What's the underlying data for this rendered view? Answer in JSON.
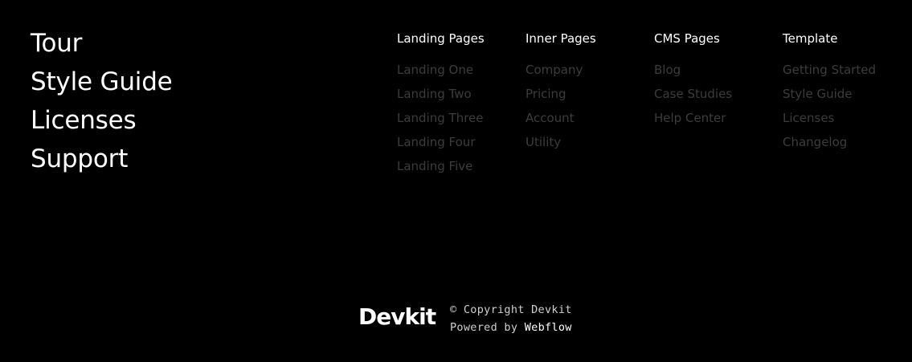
{
  "main_nav": {
    "items": [
      {
        "label": "Tour"
      },
      {
        "label": "Style Guide"
      },
      {
        "label": "Licenses"
      },
      {
        "label": "Support"
      }
    ]
  },
  "columns": [
    {
      "title": "Landing Pages",
      "links": [
        "Landing One",
        "Landing Two",
        "Landing Three",
        "Landing Four",
        "Landing Five"
      ]
    },
    {
      "title": "Inner Pages",
      "links": [
        "Company",
        "Pricing",
        "Account",
        "Utility"
      ]
    },
    {
      "title": "CMS Pages",
      "links": [
        "Blog",
        "Case Studies",
        "Help Center"
      ]
    },
    {
      "title": "Template",
      "links": [
        "Getting Started",
        "Style Guide",
        "Licenses",
        "Changelog"
      ]
    }
  ],
  "footer": {
    "logo": "Devkit",
    "copyright": "© Copyright Devkit",
    "powered_prefix": "Powered by ",
    "powered_link": "Webflow"
  },
  "colors": {
    "background": "#000000",
    "text": "#ffffff",
    "muted_link": "#3c3c3c"
  }
}
